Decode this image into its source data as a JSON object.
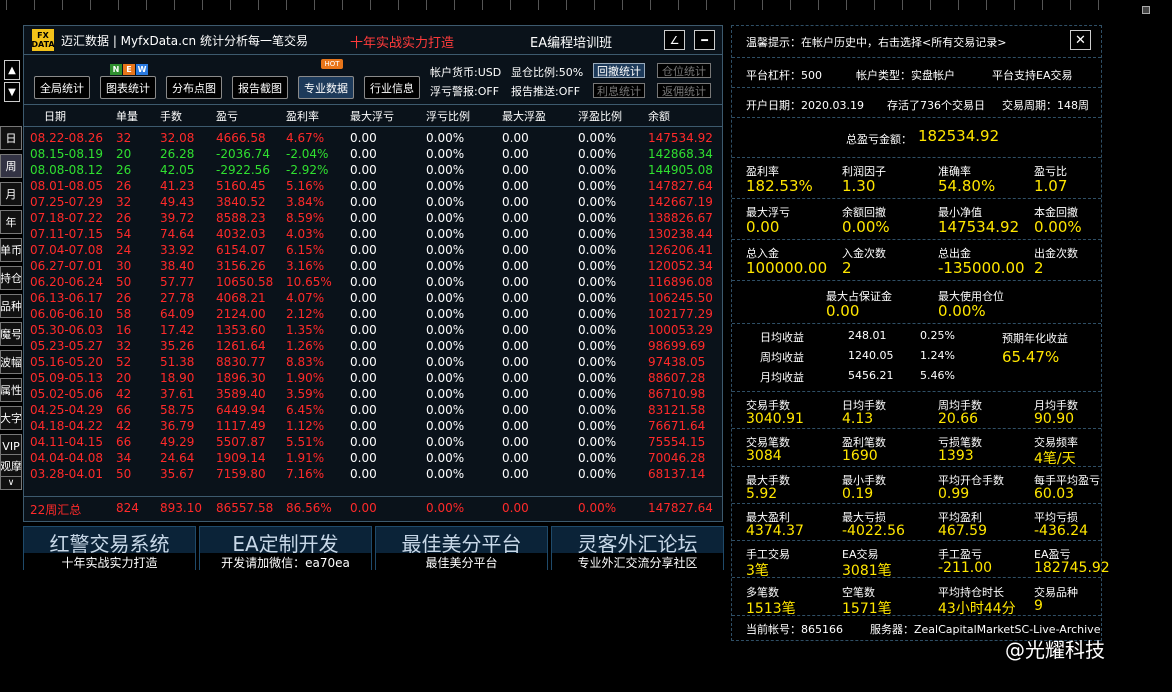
{
  "app": {
    "title": "迈汇数据 | MyfxData.cn  统计分析每一笔交易",
    "slogan": "十年实战实力打造",
    "ea_label": "EA编程培训班",
    "logo_top": "FX",
    "logo_bottom": "DATA",
    "edit_glyph": "∠",
    "min_glyph": "━"
  },
  "sidebar": {
    "up": "▲",
    "down": "▼",
    "items": [
      "日",
      "周",
      "月",
      "年",
      "单币",
      "持仓",
      "品种",
      "魔号",
      "波幅",
      "属性",
      "大字",
      "VIP",
      "观摩"
    ],
    "chev": "∨"
  },
  "toolbar": {
    "buttons": [
      "全局统计",
      "图表统计",
      "分布点图",
      "报告截图",
      "专业数据",
      "行业信息"
    ],
    "new_letters": [
      "N",
      "E",
      "W"
    ],
    "hot": "HOT"
  },
  "status": {
    "currency": "帐户货币:USD",
    "ratio": "显仓比例:50%",
    "float_alert": "浮亏警报:OFF",
    "report_push": "报告推送:OFF"
  },
  "small_buttons": {
    "withdraw_stats": "回撤统计",
    "position_stats": "仓位统计",
    "interest_stats": "利息统计",
    "rebate_stats": "返佣统计"
  },
  "table": {
    "headers": [
      "日期",
      "单量",
      "手数",
      "盈亏",
      "盈利率",
      "最大浮亏",
      "浮亏比例",
      "最大浮盈",
      "浮盈比例",
      "余额"
    ],
    "rows": [
      [
        "08.22-08.26",
        "32",
        "32.08",
        "4666.58",
        "4.67%",
        "0.00",
        "0.00%",
        "0.00",
        "0.00%",
        "147534.92",
        "r"
      ],
      [
        "08.15-08.19",
        "20",
        "26.28",
        "-2036.74",
        "-2.04%",
        "0.00",
        "0.00%",
        "0.00",
        "0.00%",
        "142868.34",
        "g"
      ],
      [
        "08.08-08.12",
        "26",
        "42.05",
        "-2922.56",
        "-2.92%",
        "0.00",
        "0.00%",
        "0.00",
        "0.00%",
        "144905.08",
        "g"
      ],
      [
        "08.01-08.05",
        "26",
        "41.23",
        "5160.45",
        "5.16%",
        "0.00",
        "0.00%",
        "0.00",
        "0.00%",
        "147827.64",
        "r"
      ],
      [
        "07.25-07.29",
        "32",
        "49.43",
        "3840.52",
        "3.84%",
        "0.00",
        "0.00%",
        "0.00",
        "0.00%",
        "142667.19",
        "r"
      ],
      [
        "07.18-07.22",
        "26",
        "39.72",
        "8588.23",
        "8.59%",
        "0.00",
        "0.00%",
        "0.00",
        "0.00%",
        "138826.67",
        "r"
      ],
      [
        "07.11-07.15",
        "54",
        "74.64",
        "4032.03",
        "4.03%",
        "0.00",
        "0.00%",
        "0.00",
        "0.00%",
        "130238.44",
        "r"
      ],
      [
        "07.04-07.08",
        "24",
        "33.92",
        "6154.07",
        "6.15%",
        "0.00",
        "0.00%",
        "0.00",
        "0.00%",
        "126206.41",
        "r"
      ],
      [
        "06.27-07.01",
        "30",
        "38.40",
        "3156.26",
        "3.16%",
        "0.00",
        "0.00%",
        "0.00",
        "0.00%",
        "120052.34",
        "r"
      ],
      [
        "06.20-06.24",
        "50",
        "57.77",
        "10650.58",
        "10.65%",
        "0.00",
        "0.00%",
        "0.00",
        "0.00%",
        "116896.08",
        "r"
      ],
      [
        "06.13-06.17",
        "26",
        "27.78",
        "4068.21",
        "4.07%",
        "0.00",
        "0.00%",
        "0.00",
        "0.00%",
        "106245.50",
        "r"
      ],
      [
        "06.06-06.10",
        "58",
        "64.09",
        "2124.00",
        "2.12%",
        "0.00",
        "0.00%",
        "0.00",
        "0.00%",
        "102177.29",
        "r"
      ],
      [
        "05.30-06.03",
        "16",
        "17.42",
        "1353.60",
        "1.35%",
        "0.00",
        "0.00%",
        "0.00",
        "0.00%",
        "100053.29",
        "r"
      ],
      [
        "05.23-05.27",
        "32",
        "35.26",
        "1261.64",
        "1.26%",
        "0.00",
        "0.00%",
        "0.00",
        "0.00%",
        "98699.69",
        "r"
      ],
      [
        "05.16-05.20",
        "52",
        "51.38",
        "8830.77",
        "8.83%",
        "0.00",
        "0.00%",
        "0.00",
        "0.00%",
        "97438.05",
        "r"
      ],
      [
        "05.09-05.13",
        "20",
        "18.90",
        "1896.30",
        "1.90%",
        "0.00",
        "0.00%",
        "0.00",
        "0.00%",
        "88607.28",
        "r"
      ],
      [
        "05.02-05.06",
        "42",
        "37.61",
        "3589.40",
        "3.59%",
        "0.00",
        "0.00%",
        "0.00",
        "0.00%",
        "86710.98",
        "r"
      ],
      [
        "04.25-04.29",
        "66",
        "58.75",
        "6449.94",
        "6.45%",
        "0.00",
        "0.00%",
        "0.00",
        "0.00%",
        "83121.58",
        "r"
      ],
      [
        "04.18-04.22",
        "42",
        "36.79",
        "1117.49",
        "1.12%",
        "0.00",
        "0.00%",
        "0.00",
        "0.00%",
        "76671.64",
        "r"
      ],
      [
        "04.11-04.15",
        "66",
        "49.29",
        "5507.87",
        "5.51%",
        "0.00",
        "0.00%",
        "0.00",
        "0.00%",
        "75554.15",
        "r"
      ],
      [
        "04.04-04.08",
        "34",
        "24.64",
        "1909.14",
        "1.91%",
        "0.00",
        "0.00%",
        "0.00",
        "0.00%",
        "70046.28",
        "r"
      ],
      [
        "03.28-04.01",
        "50",
        "35.67",
        "7159.80",
        "7.16%",
        "0.00",
        "0.00%",
        "0.00",
        "0.00%",
        "68137.14",
        "r"
      ]
    ],
    "total": [
      "22周汇总",
      "824",
      "893.10",
      "86557.58",
      "86.56%",
      "0.00",
      "0.00%",
      "0.00",
      "0.00%",
      "147827.64"
    ]
  },
  "banners": [
    {
      "big": "红警交易系统",
      "small": "十年实战实力打造"
    },
    {
      "big": "EA定制开发",
      "small": "开发请加微信：ea70ea"
    },
    {
      "big": "最佳美分平台",
      "small": "最佳美分平台"
    },
    {
      "big": "灵客外汇论坛",
      "small": "专业外汇交流分享社区"
    }
  ],
  "right": {
    "tip": "温馨提示：在帐户历史中，右击选择<所有交易记录>",
    "close": "✕",
    "leverage": "平台杠杆：500",
    "acct_type": "帐户类型：实盘帐户",
    "ea_support": "平台支持EA交易",
    "open_date": "开户日期：2020.03.19",
    "alive": "存活了736个交易日",
    "period": "交易周期：148周",
    "total_pl_label": "总盈亏金额：",
    "total_pl": "182534.92",
    "grid1": [
      [
        "盈利率",
        "182.53%"
      ],
      [
        "利润因子",
        "1.30"
      ],
      [
        "准确率",
        "54.80%"
      ],
      [
        "盈亏比",
        "1.07"
      ],
      [
        "最大浮亏",
        "0.00"
      ],
      [
        "余额回撤",
        "0.00%"
      ],
      [
        "最小净值",
        "147534.92"
      ],
      [
        "本金回撤",
        "0.00%"
      ],
      [
        "总入金",
        "100000.00"
      ],
      [
        "入金次数",
        "2"
      ],
      [
        "总出金",
        "-135000.00"
      ],
      [
        "出金次数",
        "2"
      ]
    ],
    "margin": [
      [
        "最大占保证金",
        "0.00"
      ],
      [
        "最大使用仓位",
        "0.00%"
      ]
    ],
    "returns": {
      "rows": [
        [
          "日均收益",
          "248.01",
          "0.25%"
        ],
        [
          "周均收益",
          "1240.05",
          "1.24%"
        ],
        [
          "月均收益",
          "5456.21",
          "5.46%"
        ]
      ],
      "annual_label": "预期年化收益",
      "annual": "65.47%"
    },
    "grid2": [
      [
        "交易手数",
        "3040.91"
      ],
      [
        "日均手数",
        "4.13"
      ],
      [
        "周均手数",
        "20.66"
      ],
      [
        "月均手数",
        "90.90"
      ],
      [
        "交易笔数",
        "3084"
      ],
      [
        "盈利笔数",
        "1690"
      ],
      [
        "亏损笔数",
        "1393"
      ],
      [
        "交易频率",
        "4笔/天"
      ],
      [
        "最大手数",
        "5.92"
      ],
      [
        "最小手数",
        "0.19"
      ],
      [
        "平均开仓手数",
        "0.99"
      ],
      [
        "每手平均盈亏",
        "60.03"
      ],
      [
        "最大盈利",
        "4374.37"
      ],
      [
        "最大亏损",
        "-4022.56"
      ],
      [
        "平均盈利",
        "467.59"
      ],
      [
        "平均亏损",
        "-436.24"
      ],
      [
        "手工交易",
        "3笔"
      ],
      [
        "EA交易",
        "3081笔"
      ],
      [
        "手工盈亏",
        "-211.00"
      ],
      [
        "EA盈亏",
        "182745.92"
      ],
      [
        "多笔数",
        "1513笔"
      ],
      [
        "空笔数",
        "1571笔"
      ],
      [
        "平均持仓时长",
        "43小时44分"
      ],
      [
        "交易品种",
        "9"
      ]
    ],
    "account": "当前帐号：865166",
    "server": "服务器：ZealCapitalMarketSC-Live-Archive"
  },
  "watermark": "@光耀科技",
  "colors": {
    "red": "#ff2a2a",
    "green": "#30e030",
    "yellow": "#ffe600",
    "blue_bg": "#0b2338"
  }
}
